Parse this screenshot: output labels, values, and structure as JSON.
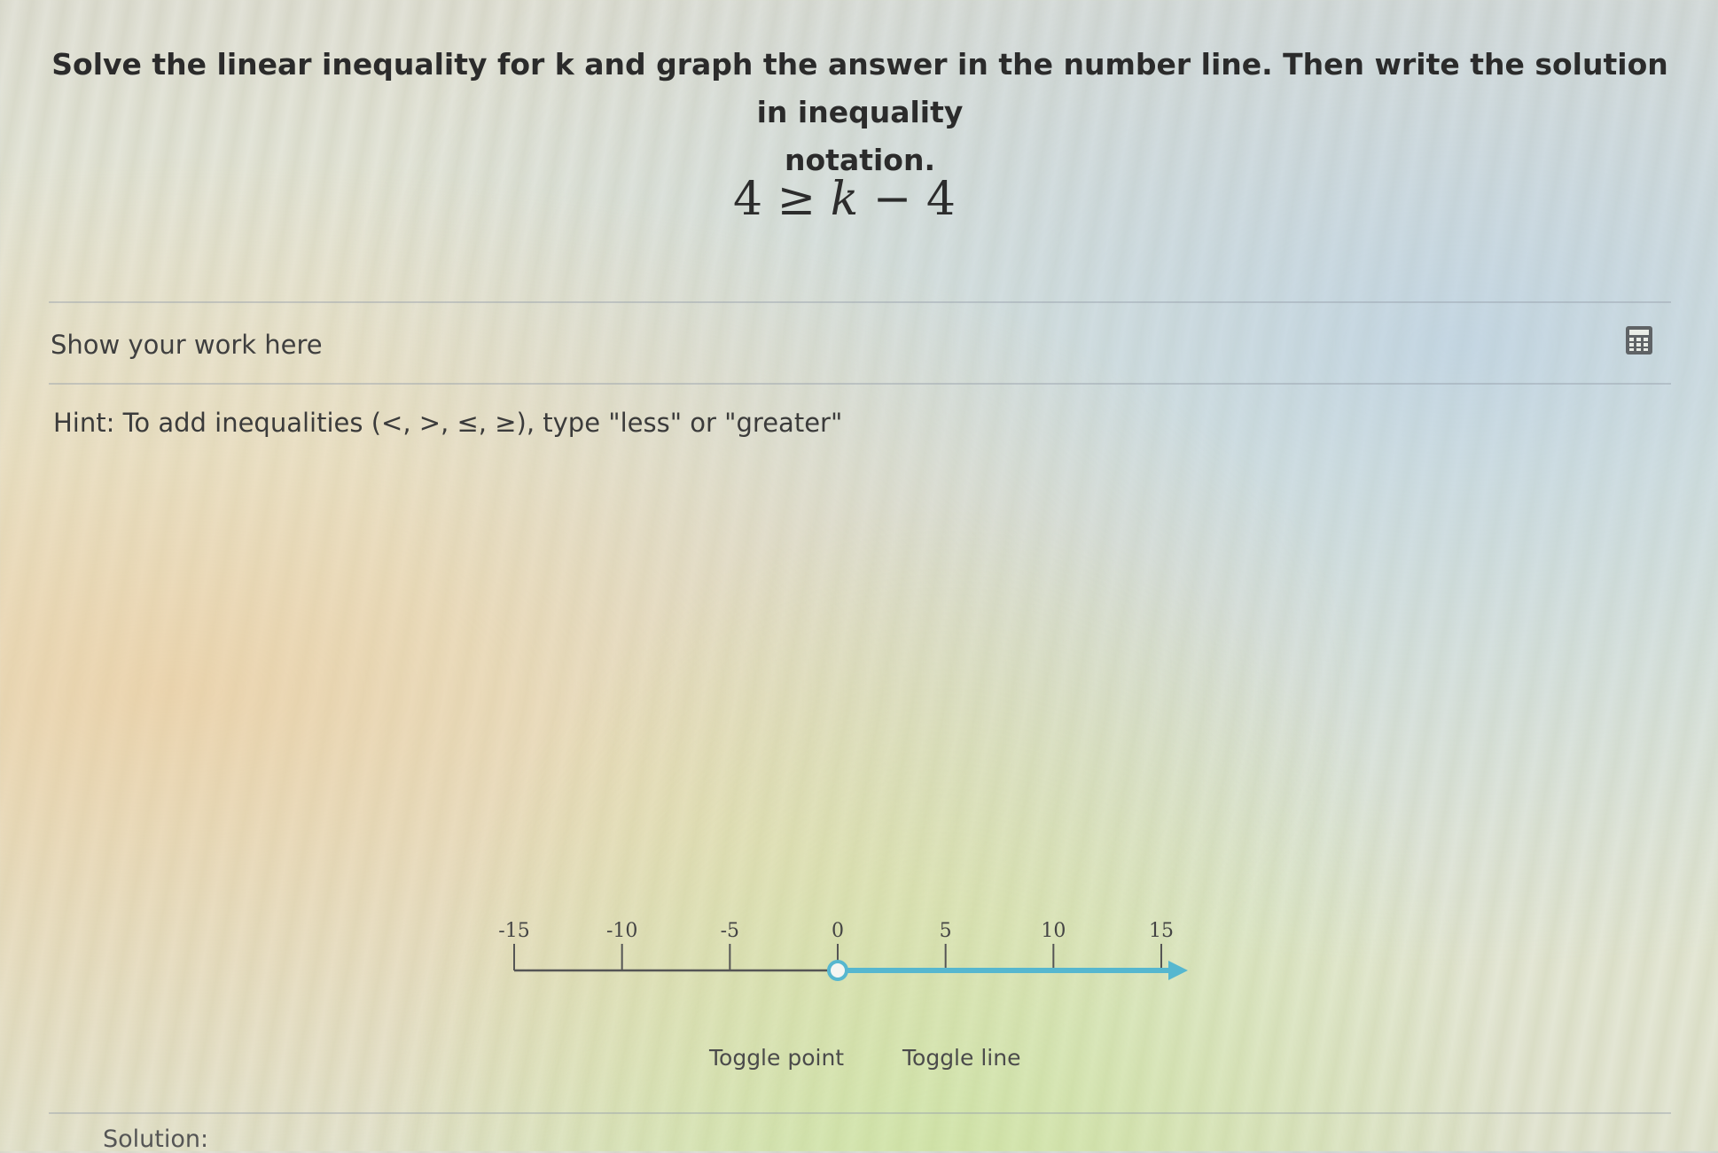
{
  "question": {
    "line1": "Solve the linear inequality for k and graph the answer in the number line. Then write the solution in inequality",
    "line2": "notation."
  },
  "equation": {
    "left": "4",
    "symbol": "≥",
    "variable": "k",
    "rest": "− 4"
  },
  "work": {
    "label": "Show your work here",
    "hint": "Hint: To add inequalities (<, >, ≤, ≥), type \"less\" or \"greater\"",
    "calculator_icon": "calculator-icon"
  },
  "number_line": {
    "min": -15,
    "max": 15,
    "tick_labels": [
      "-15",
      "-10",
      "-5",
      "0",
      "5",
      "10",
      "15"
    ],
    "point_value": 0,
    "point_style": "open",
    "ray_direction": "right",
    "ray_color": "#56b7cf",
    "axis_color": "#555555"
  },
  "controls": {
    "toggle_point": "Toggle point",
    "toggle_line": "Toggle line"
  },
  "solution": {
    "label": "Solution:"
  }
}
